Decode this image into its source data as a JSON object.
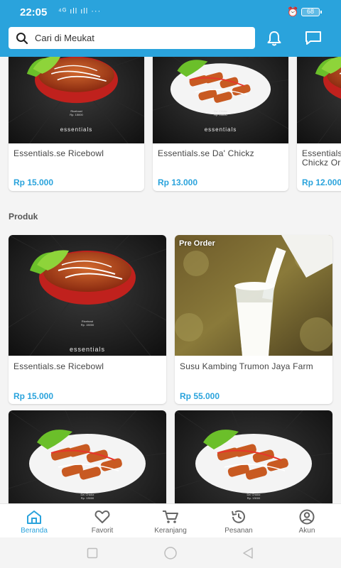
{
  "status_bar": {
    "time": "22:05",
    "signal": "⁴ᴳ ıll ıll ···",
    "battery": "68"
  },
  "search": {
    "placeholder": "Cari di Meukat"
  },
  "header_icons": [
    "bell-icon",
    "chat-icon"
  ],
  "featured": [
    {
      "name": "Essentials.se Ricebowl",
      "price": "Rp 15.000",
      "image": "ricebowl"
    },
    {
      "name": "Essentials.se Da' Chickz",
      "price": "Rp 13.000",
      "image": "chickz"
    },
    {
      "name": "Essentials.se Da' Chickz Original",
      "price": "Rp 12.000",
      "image": "ricebowl"
    }
  ],
  "produk": {
    "title": "Produk",
    "items": [
      {
        "name": "Essentials.se Ricebowl",
        "price": "Rp 15.000",
        "image": "ricebowl",
        "badge": ""
      },
      {
        "name": "Susu Kambing Trumon Jaya Farm",
        "price": "Rp 55.000",
        "image": "milk",
        "badge": "Pre Order"
      },
      {
        "name": "",
        "price": "",
        "image": "chickz",
        "badge": ""
      },
      {
        "name": "",
        "price": "",
        "image": "chickz",
        "badge": ""
      }
    ]
  },
  "image_text": {
    "brand": "essentials",
    "ricebowl_caption": "Ricebowl",
    "ricebowl_price": "Rp. 15000",
    "chickz_caption": "Da' Chickz",
    "chickz_price": "Rp. 13000"
  },
  "bottom_nav": [
    {
      "label": "Beranda",
      "icon": "home-icon",
      "active": true
    },
    {
      "label": "Favorit",
      "icon": "heart-icon",
      "active": false
    },
    {
      "label": "Keranjang",
      "icon": "cart-icon",
      "active": false
    },
    {
      "label": "Pesanan",
      "icon": "history-icon",
      "active": false
    },
    {
      "label": "Akun",
      "icon": "account-icon",
      "active": false
    }
  ],
  "colors": {
    "primary": "#2aa3dc",
    "price": "#2aa3dc",
    "background": "#f4f4f4"
  }
}
